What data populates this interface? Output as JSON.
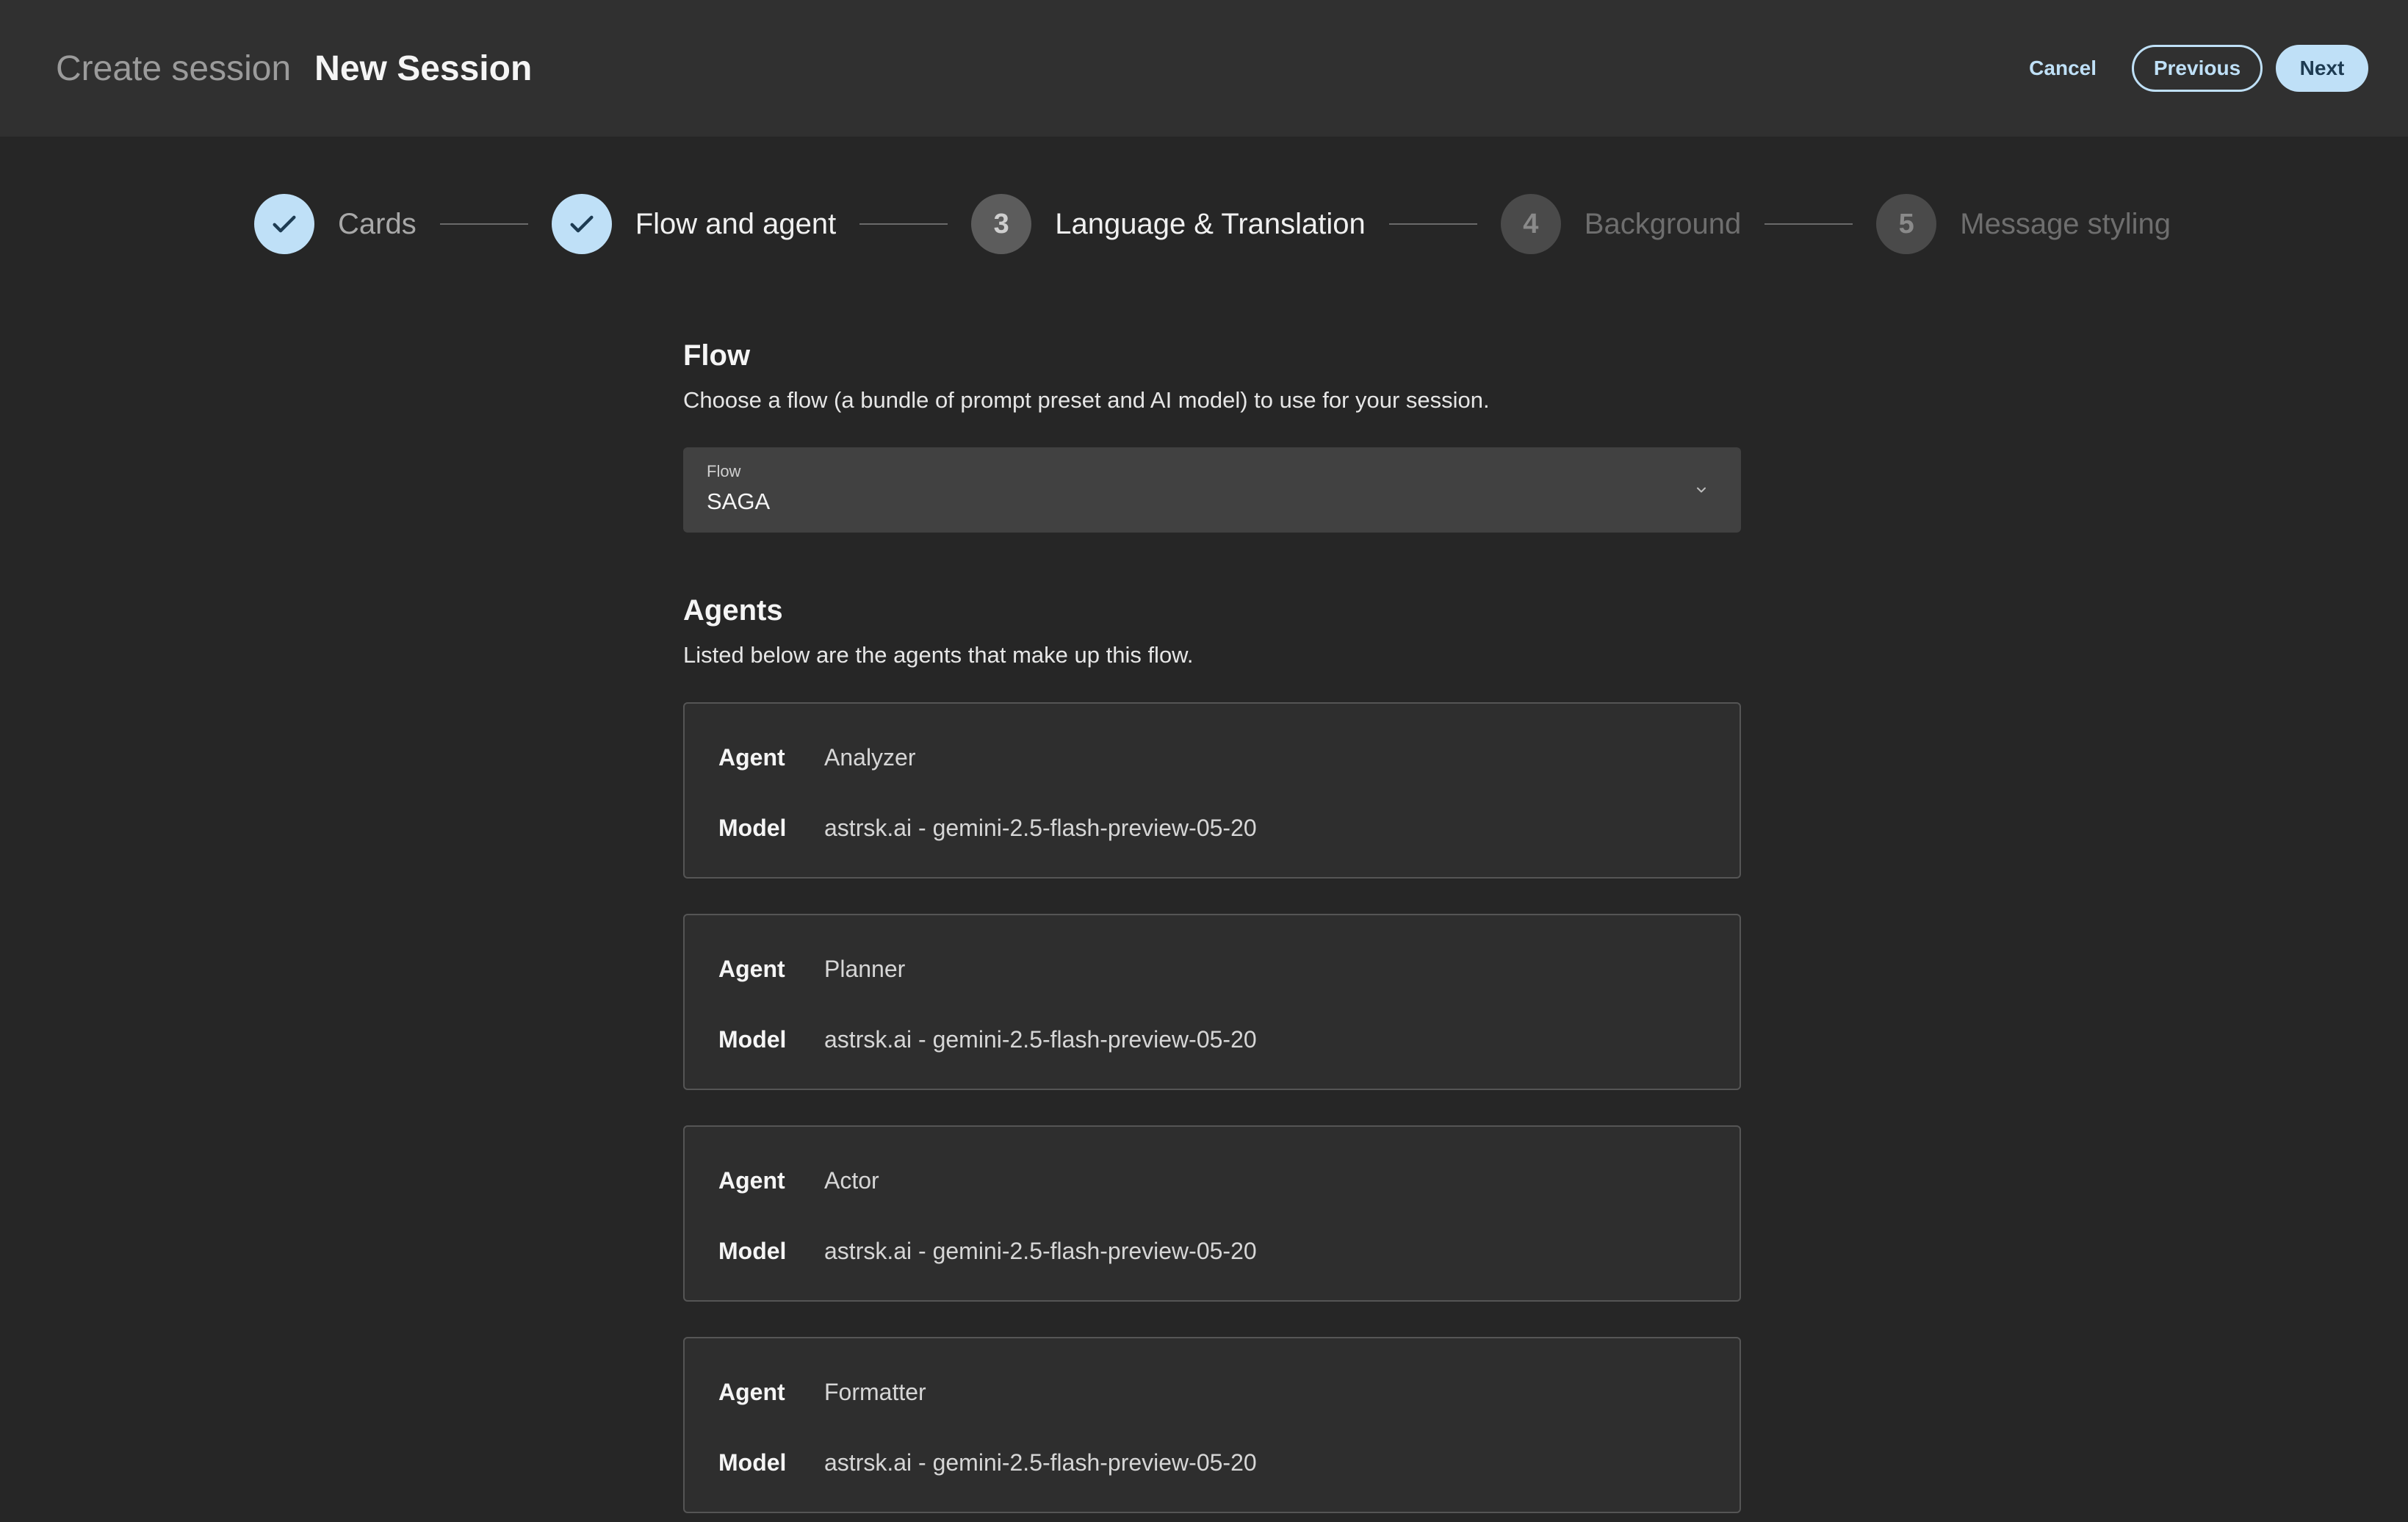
{
  "header": {
    "breadcrumb": "Create session",
    "session_name": "New Session",
    "cancel_label": "Cancel",
    "previous_label": "Previous",
    "next_label": "Next"
  },
  "stepper": {
    "steps": [
      {
        "label": "Cards",
        "state": "done",
        "number": "1"
      },
      {
        "label": "Flow and agent",
        "state": "done",
        "number": "2"
      },
      {
        "label": "Language & Translation",
        "state": "current",
        "number": "3"
      },
      {
        "label": "Background",
        "state": "upcoming",
        "number": "4"
      },
      {
        "label": "Message styling",
        "state": "upcoming",
        "number": "5"
      }
    ]
  },
  "flow": {
    "title": "Flow",
    "description": "Choose a flow (a bundle of prompt preset and AI model) to use for your session.",
    "select_label": "Flow",
    "select_value": "SAGA"
  },
  "agents": {
    "title": "Agents",
    "description": "Listed below are the agents that make up this flow.",
    "agent_key": "Agent",
    "model_key": "Model",
    "items": [
      {
        "agent": "Analyzer",
        "model": "astrsk.ai - gemini-2.5-flash-preview-05-20"
      },
      {
        "agent": "Planner",
        "model": "astrsk.ai - gemini-2.5-flash-preview-05-20"
      },
      {
        "agent": "Actor",
        "model": "astrsk.ai - gemini-2.5-flash-preview-05-20"
      },
      {
        "agent": "Formatter",
        "model": "astrsk.ai - gemini-2.5-flash-preview-05-20"
      }
    ]
  },
  "colors": {
    "accent": "#bfe0f7",
    "background": "#262626",
    "header_bg": "#303030"
  }
}
